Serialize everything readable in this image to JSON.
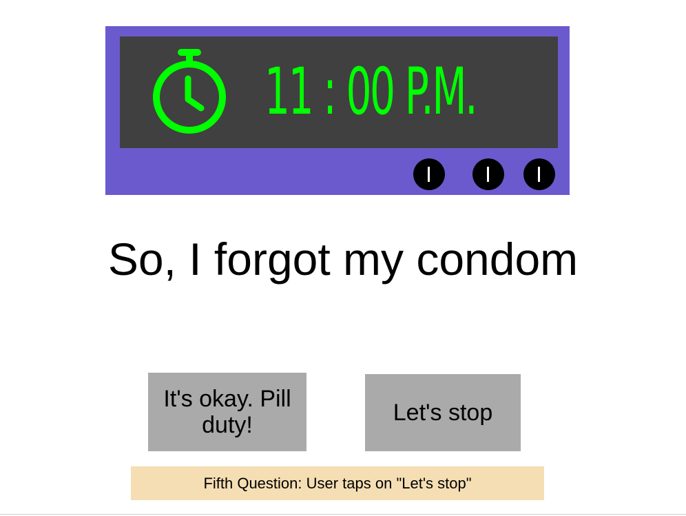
{
  "clock": {
    "time": "11 : 00 P.M.",
    "icon": "stopwatch-icon",
    "display_color": "#00ff00",
    "frame_color": "#6a5acd",
    "screen_color": "#404040"
  },
  "question": {
    "text": "So, I forgot my condom"
  },
  "answers": [
    {
      "label": "It's okay. Pill duty!"
    },
    {
      "label": "Let's stop"
    }
  ],
  "caption": {
    "text": "Fifth Question: User taps on \"Let's stop\"",
    "background": "#f5deb3"
  },
  "colors": {
    "button": "#aaaaaa"
  }
}
